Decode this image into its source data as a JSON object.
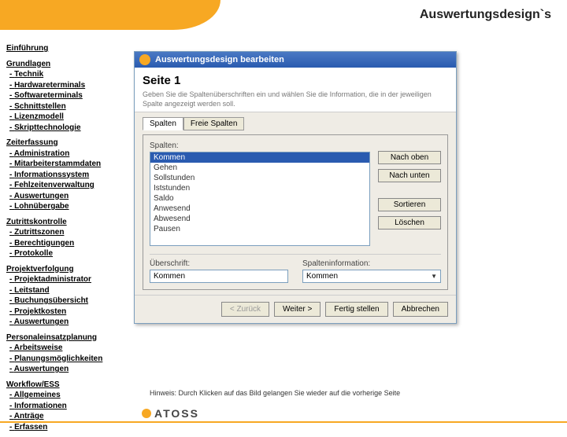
{
  "page_title": "Auswertungsdesign`s",
  "nav": [
    {
      "head": "Einführung",
      "items": []
    },
    {
      "head": "Grundlagen",
      "items": [
        "Technik",
        "Hardwareterminals",
        "Softwareterminals",
        "Schnittstellen",
        "Lizenzmodell",
        "Skripttechnologie"
      ]
    },
    {
      "head": "Zeiterfassung",
      "items": [
        "Administration",
        "Mitarbeiterstammdaten",
        "Informationssystem",
        "Fehlzeitenverwaltung",
        "Auswertungen",
        "Lohnübergabe"
      ]
    },
    {
      "head": "Zutrittskontrolle",
      "items": [
        "Zutrittszonen",
        "Berechtigungen",
        "Protokolle"
      ]
    },
    {
      "head": "Projektverfolgung",
      "items": [
        "Projektadministrator",
        "Leitstand",
        "Buchungsübersicht",
        "Projektkosten",
        "Auswertungen"
      ]
    },
    {
      "head": "Personaleinsatzplanung",
      "items": [
        "Arbeitsweise",
        "Planungsmöglichkeiten",
        "Auswertungen"
      ]
    },
    {
      "head": "Workflow/ESS",
      "items": [
        "Allgemeines",
        "Informationen",
        "Anträge",
        "Erfassen"
      ]
    }
  ],
  "dialog": {
    "title": "Auswertungsdesign bearbeiten",
    "heading": "Seite 1",
    "description": "Geben Sie die Spaltenüberschriften ein und wählen Sie die Information, die in der jeweiligen Spalte angezeigt werden soll.",
    "tabs": [
      "Spalten",
      "Freie Spalten"
    ],
    "list_label": "Spalten:",
    "list_items": [
      "Kommen",
      "Gehen",
      "Sollstunden",
      "Iststunden",
      "Saldo",
      "Anwesend",
      "Abwesend",
      "Pausen"
    ],
    "selected_item": "Kommen",
    "buttons": {
      "up": "Nach oben",
      "down": "Nach unten",
      "sort": "Sortieren",
      "delete": "Löschen"
    },
    "field_caption_label": "Überschrift:",
    "field_caption_value": "Kommen",
    "field_info_label": "Spalteninformation:",
    "field_info_value": "Kommen",
    "footer": {
      "back": "< Zurück",
      "next": "Weiter >",
      "finish": "Fertig stellen",
      "cancel": "Abbrechen"
    }
  },
  "hint": "Hinweis: Durch Klicken auf das Bild gelangen Sie wieder auf die vorherige Seite",
  "brand": "ATOSS"
}
